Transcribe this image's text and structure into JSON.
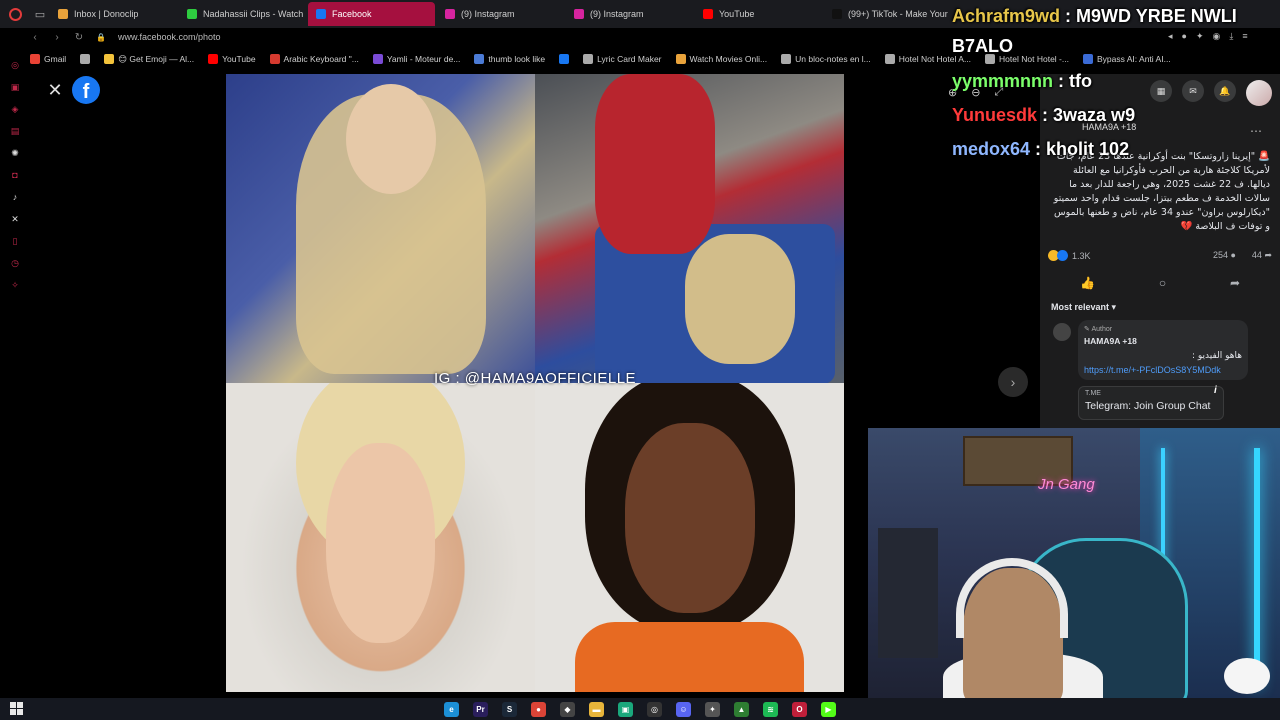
{
  "browser": {
    "tabs": [
      {
        "title": "Inbox | Donoclip",
        "color": "#e9a33b",
        "active": false
      },
      {
        "title": "Nadahassii Clips - Watch",
        "color": "#2ecc40",
        "active": false
      },
      {
        "title": "Facebook",
        "color": "#1877f2",
        "active": true
      },
      {
        "title": "(9) Instagram",
        "color": "#d6249f",
        "active": false
      },
      {
        "title": "(9) Instagram",
        "color": "#d6249f",
        "active": false
      },
      {
        "title": "YouTube",
        "color": "#ff0000",
        "active": false
      },
      {
        "title": "(99+) TikTok - Make Your",
        "color": "#111111",
        "active": false
      }
    ],
    "url": "www.facebook.com/photo",
    "bookmarks": [
      {
        "label": "Gmail",
        "color": "#ea4335"
      },
      {
        "label": "",
        "color": "#aaaaaa"
      },
      {
        "label": "😊 Get Emoji — Al...",
        "color": "#f3c33b"
      },
      {
        "label": "YouTube",
        "color": "#ff0000"
      },
      {
        "label": "Arabic Keyboard \"...",
        "color": "#d63a2f"
      },
      {
        "label": "Yamli - Moteur de...",
        "color": "#7a4bd6"
      },
      {
        "label": "thumb look like",
        "color": "#4b7bd6"
      },
      {
        "label": "",
        "color": "#1877f2"
      },
      {
        "label": "Lyric Card Maker",
        "color": "#aaaaaa"
      },
      {
        "label": "Watch Movies Onli...",
        "color": "#e9a33b"
      },
      {
        "label": "Un bloc-notes en l...",
        "color": "#aaaaaa"
      },
      {
        "label": "Hotel Not Hotel A...",
        "color": "#aaaaaa"
      },
      {
        "label": "Hotel Not Hotel -...",
        "color": "#aaaaaa"
      },
      {
        "label": "Bypass AI: Anti AI...",
        "color": "#3b6bd6"
      }
    ]
  },
  "viewer": {
    "watermark": "IG : @HAMA9AOFFICIELLE",
    "close_glyph": "✕",
    "next_glyph": "›"
  },
  "post": {
    "author": "HAMA9A +18",
    "text": "🚨 \"إيرينا زاروتسكا\" بنت أوكرانية عندها 23 عام، جات لأمريكا كلاجئة هاربة من الحرب فأوكرانيا مع العائلة ديالها. ف 22 غشت 2025، وهي راجعة للدار بعد ما سالات الخدمة ف مطعم بيتزا، جلست قدام واحد سميتو \"ديكارلوس براون\" عندو 34 عام، ناض و طعنها بالموس و توفات ف البلاصة 💔",
    "reactions_count": "1.3K",
    "comments_count": "254",
    "shares_count": "44",
    "sort_label": "Most relevant",
    "comment": {
      "badge": "Author",
      "name": "HAMA9A +18",
      "text": "هاهو الفيديو :",
      "link": "https://t.me/+-PFclDOsS8Y5MDdk"
    },
    "link_card": {
      "domain": "T.ME",
      "title": "Telegram: Join Group Chat"
    }
  },
  "chat_messages": [
    {
      "user": "Achrafm9wd",
      "text": " : M9WD YRBE NWLI",
      "color": "#e7c64a"
    },
    {
      "user": "",
      "text": "B7ALO",
      "color": "#ffffff"
    },
    {
      "user": "yymmmnnn",
      "text": " : tfo",
      "color": "#7cff6b"
    },
    {
      "user": "Yunuesdk",
      "text": " : 3waza w9",
      "color": "#ff3a3a"
    },
    {
      "user": "medox64",
      "text": " : kholit 102",
      "color": "#8fb7ff"
    }
  ],
  "webcam": {
    "neon_sign": "Jn Gang"
  },
  "taskbar": {
    "apps": [
      {
        "name": "edge",
        "color": "#1c8fd6",
        "glyph": "e"
      },
      {
        "name": "premiere",
        "color": "#2a1e5c",
        "glyph": "Pr"
      },
      {
        "name": "steam",
        "color": "#1b2838",
        "glyph": "S"
      },
      {
        "name": "chrome",
        "color": "#db4437",
        "glyph": "●"
      },
      {
        "name": "app",
        "color": "#444444",
        "glyph": "◆"
      },
      {
        "name": "folder",
        "color": "#e8b53a",
        "glyph": "▬"
      },
      {
        "name": "app2",
        "color": "#1aa87c",
        "glyph": "▣"
      },
      {
        "name": "obs",
        "color": "#333333",
        "glyph": "◎"
      },
      {
        "name": "discord",
        "color": "#5865f2",
        "glyph": "☺"
      },
      {
        "name": "app3",
        "color": "#555555",
        "glyph": "✦"
      },
      {
        "name": "nvidia",
        "color": "#2e7d32",
        "glyph": "▲"
      },
      {
        "name": "spotify",
        "color": "#1db954",
        "glyph": "≋"
      },
      {
        "name": "opera",
        "color": "#c01f3a",
        "glyph": "O"
      },
      {
        "name": "kick",
        "color": "#53fc18",
        "glyph": "▶"
      }
    ]
  }
}
